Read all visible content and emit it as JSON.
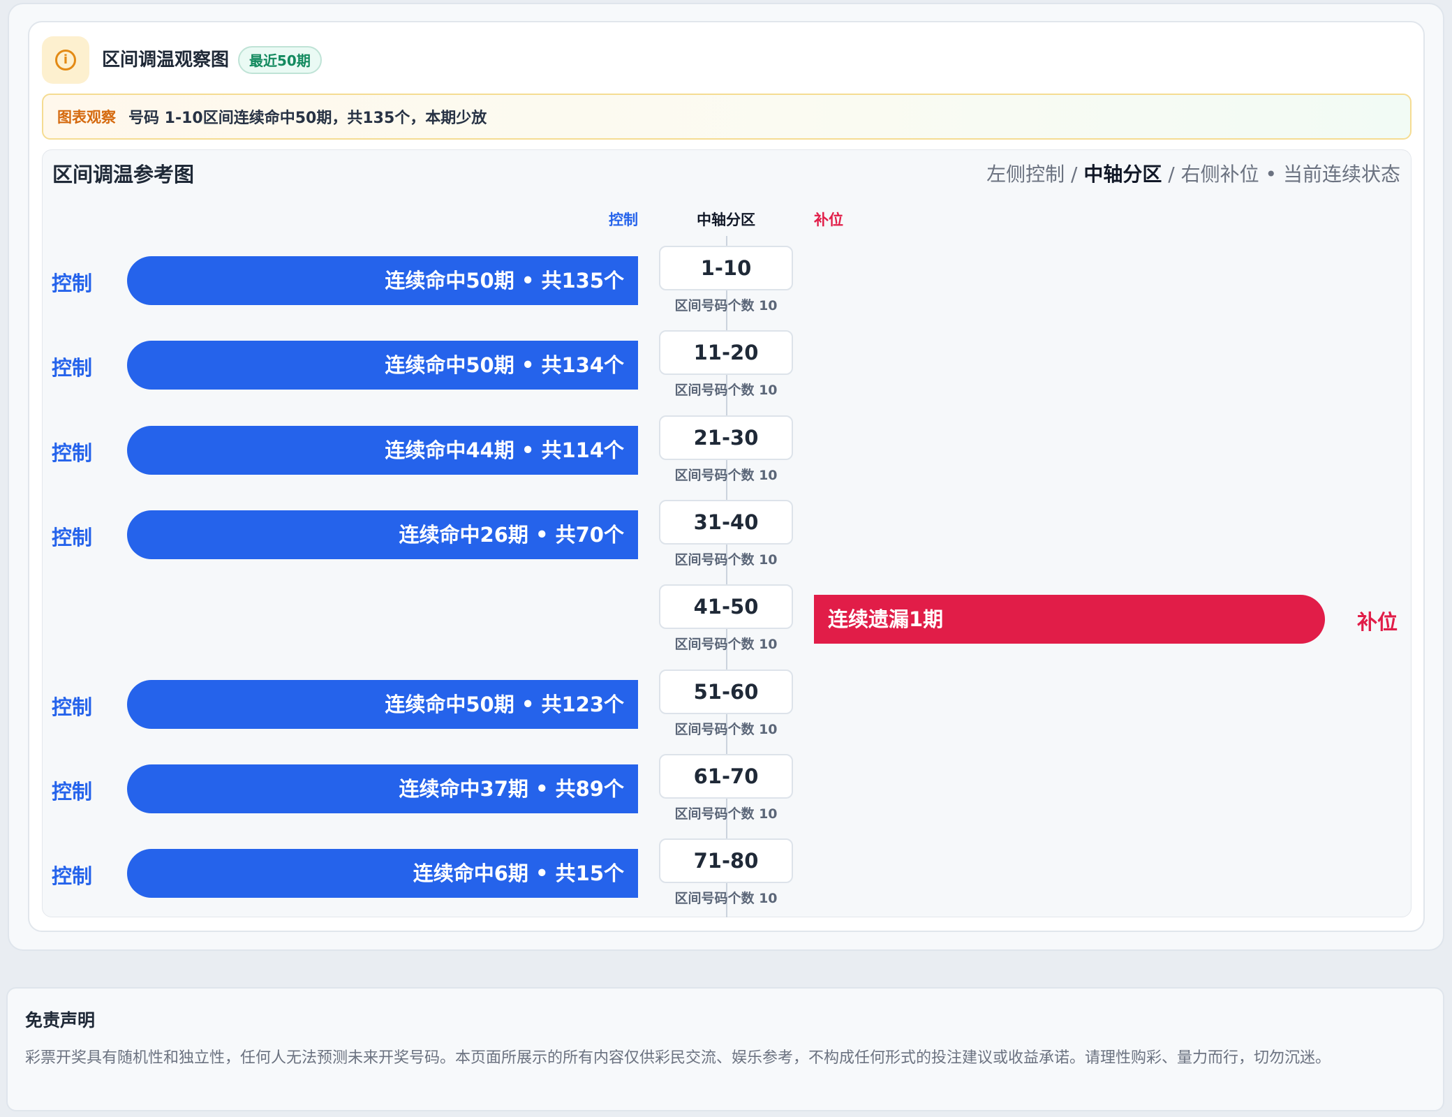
{
  "header": {
    "icon": "info-icon",
    "title": "区间调温观察图",
    "badge": "最近50期"
  },
  "notice": {
    "tag": "图表观察",
    "text": "号码 1-10区间连续命中50期，共135个，本期少放"
  },
  "chart": {
    "title": "区间调温参考图",
    "legend": {
      "left": "左侧控制",
      "sep1": " / ",
      "middle": "中轴分区",
      "sep2": " / ",
      "right": "右侧补位",
      "sep3": " • ",
      "state": "当前连续状态"
    },
    "column_heads": {
      "left": "控制",
      "middle": "中轴分区",
      "right": "补位"
    },
    "colors": {
      "control": "#2563eb",
      "fill": "#e11d48"
    }
  },
  "chart_data": {
    "type": "bar",
    "categories": [
      "1-10",
      "11-20",
      "21-30",
      "31-40",
      "41-50",
      "51-60",
      "61-70",
      "71-80"
    ],
    "rows": [
      {
        "range": "1-10",
        "side": "控制",
        "bar_text": "连续命中50期 • 共135个",
        "sub": "区间号码个数 10",
        "streak": 50,
        "total": 135
      },
      {
        "range": "11-20",
        "side": "控制",
        "bar_text": "连续命中50期 • 共134个",
        "sub": "区间号码个数 10",
        "streak": 50,
        "total": 134
      },
      {
        "range": "21-30",
        "side": "控制",
        "bar_text": "连续命中44期 • 共114个",
        "sub": "区间号码个数 10",
        "streak": 44,
        "total": 114
      },
      {
        "range": "31-40",
        "side": "控制",
        "bar_text": "连续命中26期 • 共70个",
        "sub": "区间号码个数 10",
        "streak": 26,
        "total": 70
      },
      {
        "range": "41-50",
        "side": "补位",
        "bar_text": "连续遗漏1期",
        "sub": "区间号码个数 10",
        "streak": 1
      },
      {
        "range": "51-60",
        "side": "控制",
        "bar_text": "连续命中50期 • 共123个",
        "sub": "区间号码个数 10",
        "streak": 50,
        "total": 123
      },
      {
        "range": "61-70",
        "side": "控制",
        "bar_text": "连续命中37期 • 共89个",
        "sub": "区间号码个数 10",
        "streak": 37,
        "total": 89
      },
      {
        "range": "71-80",
        "side": "控制",
        "bar_text": "连续命中6期 • 共15个",
        "sub": "区间号码个数 10",
        "streak": 6,
        "total": 15
      }
    ]
  },
  "disclaimer": {
    "title": "免责声明",
    "text": "彩票开奖具有随机性和独立性，任何人无法预测未来开奖号码。本页面所展示的所有内容仅供彩民交流、娱乐参考，不构成任何形式的投注建议或收益承诺。请理性购彩、量力而行，切勿沉迷。"
  }
}
